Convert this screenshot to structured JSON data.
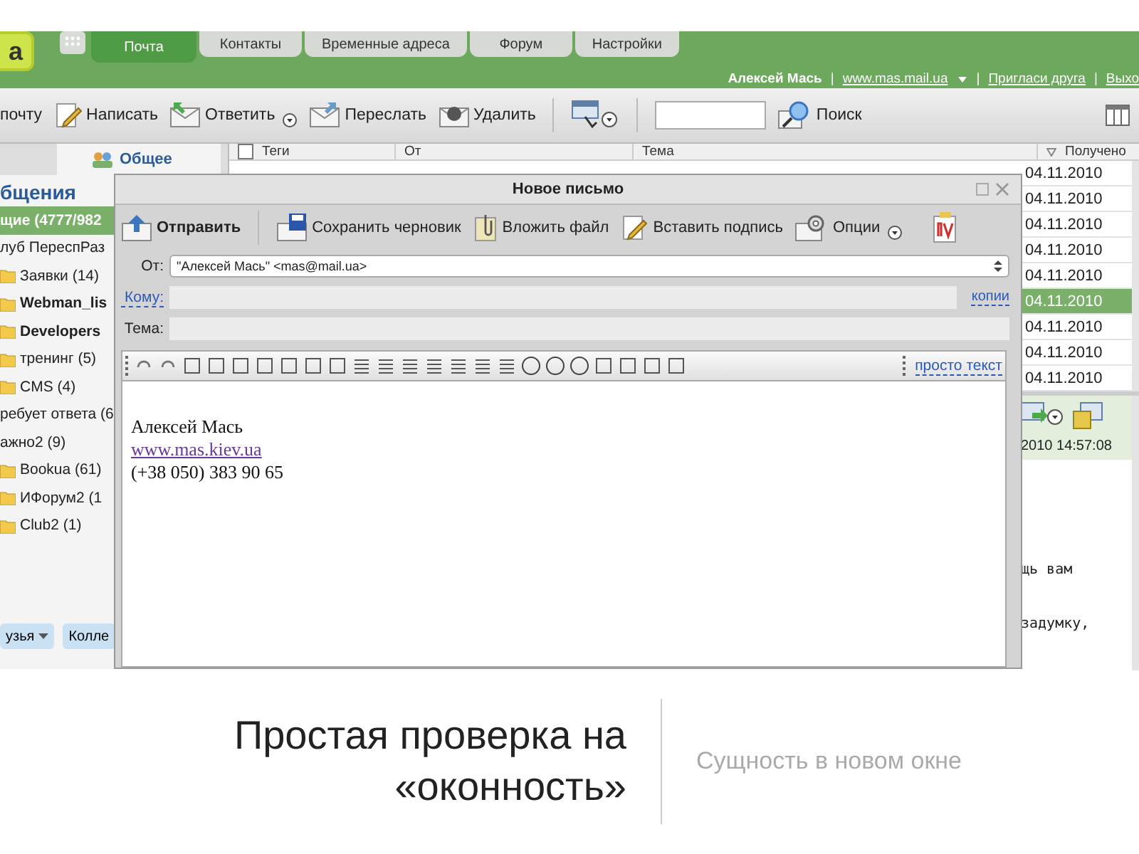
{
  "header": {
    "logo": "a",
    "nav_tabs": [
      {
        "label": "Почта",
        "selected": true
      },
      {
        "label": "Контакты",
        "selected": false
      },
      {
        "label": "Временные адреса",
        "selected": false
      },
      {
        "label": "Форум",
        "selected": false
      },
      {
        "label": "Настройки",
        "selected": false
      }
    ],
    "user_name": "Алексей Мась",
    "links": [
      "www.mas.mail.ua",
      "Пригласи друга",
      "Выхо"
    ],
    "separator": "|"
  },
  "toolbar": {
    "buttons": [
      {
        "label": "почту",
        "kind": "plain",
        "has_menu": false
      },
      {
        "label": "Написать",
        "kind": "compose",
        "has_menu": false
      },
      {
        "label": "Ответить",
        "kind": "reply",
        "has_menu": true
      },
      {
        "label": "Переслать",
        "kind": "forward",
        "has_menu": false
      },
      {
        "label": "Удалить",
        "kind": "delete",
        "has_menu": false
      }
    ],
    "search_button": "Поиск"
  },
  "sidebar": {
    "tab": "Общее",
    "heading": "бщения",
    "items": [
      {
        "label": "щие (4777/982",
        "kind": "group",
        "unread": true,
        "selected": true
      },
      {
        "label": "луб ПереспРаз",
        "kind": "group",
        "unread": false,
        "selected": false
      },
      {
        "label": "Заявки (14)",
        "kind": "folder",
        "unread": false,
        "selected": false
      },
      {
        "label": "Webman_lis",
        "kind": "folder",
        "unread": true,
        "selected": false
      },
      {
        "label": "Developers",
        "kind": "folder",
        "unread": true,
        "selected": false
      },
      {
        "label": "тренинг (5)",
        "kind": "folder",
        "unread": false,
        "selected": false
      },
      {
        "label": "CMS (4)",
        "kind": "folder",
        "unread": false,
        "selected": false
      },
      {
        "label": "ребует ответа (6",
        "kind": "group",
        "unread": false,
        "selected": false
      },
      {
        "label": "ажно2 (9)",
        "kind": "group",
        "unread": false,
        "selected": false
      },
      {
        "label": "Bookua (61)",
        "kind": "folder",
        "unread": false,
        "selected": false
      },
      {
        "label": "ИФорум2 (1",
        "kind": "folder",
        "unread": false,
        "selected": false
      },
      {
        "label": "Club2 (1)",
        "kind": "folder",
        "unread": false,
        "selected": false
      }
    ],
    "bottom_buttons": [
      {
        "label": "узья",
        "has_menu": true
      },
      {
        "label": "Колле",
        "has_menu": false
      }
    ]
  },
  "message_list": {
    "columns": [
      "Теги",
      "От",
      "Тема",
      "Получено"
    ],
    "dates": [
      {
        "text": "04.11.2010",
        "selected": false
      },
      {
        "text": "04.11.2010",
        "selected": false
      },
      {
        "text": "04.11.2010",
        "selected": false
      },
      {
        "text": "04.11.2010",
        "selected": false
      },
      {
        "text": "04.11.2010",
        "selected": false
      },
      {
        "text": "04.11.2010",
        "selected": true
      },
      {
        "text": "04.11.2010",
        "selected": false
      },
      {
        "text": "04.11.2010",
        "selected": false
      },
      {
        "text": "04.11.2010",
        "selected": false
      }
    ]
  },
  "preview": {
    "date": "2010 14:57:08",
    "lines": [
      "щь вам",
      "задумку,"
    ]
  },
  "dialog": {
    "title": "Новое письмо",
    "buttons": [
      {
        "label": "Отправить",
        "kind": "send",
        "has_menu": false
      },
      {
        "label": "Сохранить черновик",
        "kind": "save",
        "has_menu": false
      },
      {
        "label": "Вложить файл",
        "kind": "attach",
        "has_menu": false
      },
      {
        "label": "Вставить подпись",
        "kind": "signature",
        "has_menu": false
      },
      {
        "label": "Опции",
        "kind": "options",
        "has_menu": true
      }
    ],
    "from_label": "От:",
    "from_value": "\"Алексей Мась\" <mas@mail.ua>",
    "to_label": "Кому:",
    "cc_link": "копии",
    "subject_label": "Тема:",
    "plain_text_link": "просто текст",
    "signature": {
      "name": "Алексей Мась",
      "site": "www.mas.kiev.ua",
      "phone": "(+38 050) 383 90 65"
    }
  },
  "slide": {
    "title": "Простая проверка на «оконность»",
    "subtitle": "Сущность в новом окне"
  }
}
